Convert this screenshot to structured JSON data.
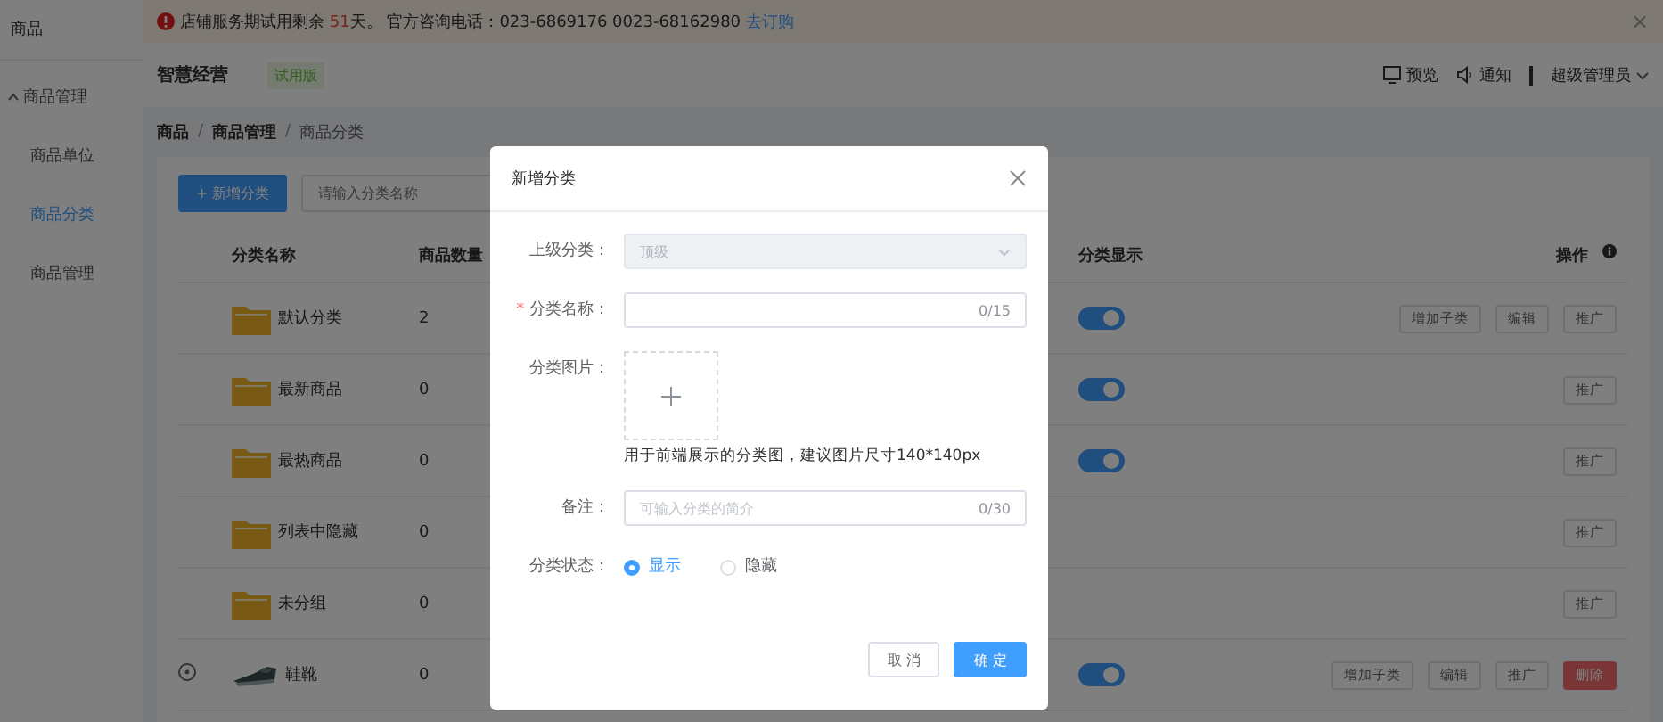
{
  "sidebar": {
    "title": "商品",
    "groups": [
      {
        "label": "商品管理",
        "expanded": true,
        "items": [
          {
            "label": "商品单位",
            "selected": false
          },
          {
            "label": "商品分类",
            "selected": true
          },
          {
            "label": "商品管理",
            "selected": false
          }
        ]
      }
    ]
  },
  "notice": {
    "text": "店铺服务期试用剩余 ",
    "days": "51",
    "days_suffix": "天。",
    "contact": " 官方咨询电话：023-6869176 0023-68162980 ",
    "link": "去订购",
    "close": "×"
  },
  "header": {
    "brand": "智慧经营",
    "badge": "试用版",
    "actions": [
      {
        "kind": "preview",
        "label": "预览"
      },
      {
        "kind": "notify",
        "label": "通知"
      }
    ],
    "user": "超级管理员"
  },
  "breadcrumb": [
    {
      "label": "商品"
    },
    {
      "label": "商品管理"
    },
    {
      "label": "商品分类"
    }
  ],
  "breadcrumb_separator": "/",
  "toolbar": {
    "add_button": "+ 新增分类",
    "search_placeholder": "请输入分类名称"
  },
  "table": {
    "columns": [
      "分类名称",
      "商品数量",
      "分类显示",
      "操作"
    ],
    "rows": [
      {
        "kind": "folder",
        "name": "默认分类",
        "count": "2",
        "display": true,
        "actions": [
          {
            "label": "增加子类",
            "kind": "normal"
          },
          {
            "label": "编辑",
            "kind": "normal"
          },
          {
            "label": "推广",
            "kind": "normal"
          }
        ]
      },
      {
        "kind": "folder",
        "name": "最新商品",
        "count": "0",
        "display": true,
        "actions": [
          {
            "label": "推广",
            "kind": "normal"
          }
        ]
      },
      {
        "kind": "folder",
        "name": "最热商品",
        "count": "0",
        "display": true,
        "actions": [
          {
            "label": "推广",
            "kind": "normal"
          }
        ]
      },
      {
        "kind": "folder",
        "name": "列表中隐藏",
        "count": "0",
        "actions": [
          {
            "label": "推广",
            "kind": "normal"
          }
        ]
      },
      {
        "kind": "folder",
        "name": "未分组",
        "count": "0",
        "actions": [
          {
            "label": "推广",
            "kind": "normal"
          }
        ]
      },
      {
        "kind": "picture",
        "name": "鞋靴",
        "count": "0",
        "expandable": true,
        "display": true,
        "actions": [
          {
            "label": "增加子类",
            "kind": "normal"
          },
          {
            "label": "编辑",
            "kind": "normal"
          },
          {
            "label": "推广",
            "kind": "normal"
          },
          {
            "label": "删除",
            "kind": "danger"
          }
        ]
      }
    ]
  },
  "dialog": {
    "title": "新增分类",
    "required_mark": "*",
    "fields": [
      {
        "kind": "select",
        "label": "上级分类：",
        "value": "顶级",
        "disabled": true
      },
      {
        "kind": "text",
        "label": "分类名称：",
        "required": true,
        "counter": "0/15"
      },
      {
        "kind": "upload",
        "label": "分类图片：",
        "hint": "用于前端展示的分类图，建议图片尺寸140*140px"
      },
      {
        "kind": "text",
        "label": "备注：",
        "placeholder": "可输入分类的简介",
        "counter": "0/30"
      },
      {
        "kind": "radio",
        "label": "分类状态：",
        "options": [
          {
            "label": "显示",
            "selected": true
          },
          {
            "label": "隐藏",
            "selected": false
          }
        ]
      }
    ],
    "buttons": [
      {
        "label": "取 消",
        "kind": "default"
      },
      {
        "label": "确 定",
        "kind": "primary"
      }
    ]
  }
}
